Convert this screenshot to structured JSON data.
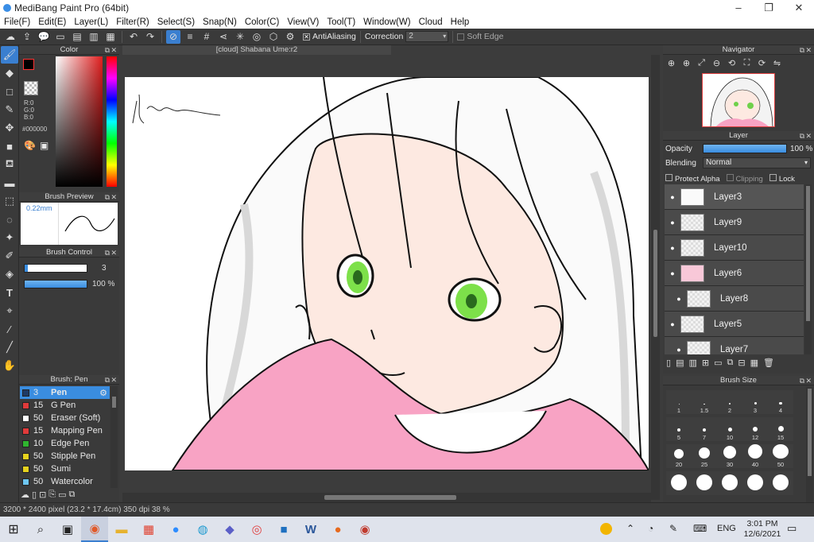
{
  "window": {
    "title": "MediBang Paint Pro (64bit)"
  },
  "menu": [
    "File(F)",
    "Edit(E)",
    "Layer(L)",
    "Filter(R)",
    "Select(S)",
    "Snap(N)",
    "Color(C)",
    "View(V)",
    "Tool(T)",
    "Window(W)",
    "Cloud",
    "Help"
  ],
  "toolbar": {
    "antialiasing_label": "AntiAliasing",
    "correction_label": "Correction",
    "correction_value": "2",
    "softedge_label": "Soft Edge"
  },
  "doc_tab": "[cloud] Shabana Ume:r2",
  "color_panel": {
    "title": "Color",
    "r": "R:0",
    "g": "G:0",
    "b": "B:0",
    "hex": "#000000",
    "primary_color": "#000000"
  },
  "brush_preview": {
    "title": "Brush Preview",
    "size": "0.22mm"
  },
  "brush_control": {
    "title": "Brush Control",
    "size_value": "3",
    "opacity_value": "100 %"
  },
  "brush_list": {
    "title": "Brush: Pen",
    "items": [
      {
        "size": "3",
        "name": "Pen",
        "color": "#1e3a66"
      },
      {
        "size": "15",
        "name": "G Pen",
        "color": "#e03a3a"
      },
      {
        "size": "50",
        "name": "Eraser (Soft)",
        "color": "#ffffff"
      },
      {
        "size": "15",
        "name": "Mapping Pen",
        "color": "#e03a3a"
      },
      {
        "size": "10",
        "name": "Edge Pen",
        "color": "#2fb52f"
      },
      {
        "size": "50",
        "name": "Stipple Pen",
        "color": "#e6d21e"
      },
      {
        "size": "50",
        "name": "Sumi",
        "color": "#e6d21e"
      },
      {
        "size": "50",
        "name": "Watercolor",
        "color": "#6ec6f0"
      }
    ]
  },
  "navigator": {
    "title": "Navigator"
  },
  "layer_panel": {
    "title": "Layer",
    "opacity_label": "Opacity",
    "opacity_value": "100 %",
    "blending_label": "Blending",
    "blending_value": "Normal",
    "protect_alpha": "Protect Alpha",
    "clipping": "Clipping",
    "lock": "Lock",
    "layers": [
      {
        "name": "Layer3"
      },
      {
        "name": "Layer9"
      },
      {
        "name": "Layer10"
      },
      {
        "name": "Layer6"
      },
      {
        "name": "Layer8"
      },
      {
        "name": "Layer5"
      },
      {
        "name": "Layer7"
      }
    ]
  },
  "brush_size": {
    "title": "Brush Size",
    "sizes": [
      "1",
      "1.5",
      "2",
      "3",
      "4",
      "5",
      "7",
      "10",
      "12",
      "15",
      "20",
      "25",
      "30",
      "40",
      "50"
    ]
  },
  "status": {
    "dimensions": "3200 * 2400 pixel",
    "physical": "(23.2 * 17.4cm)",
    "dpi": "350 dpi",
    "zoom": "38 %"
  },
  "taskbar": {
    "lang": "ENG",
    "time": "3:01 PM",
    "date": "12/6/2021"
  },
  "icons": [
    "brush-icon",
    "eraser-icon",
    "rectangle-icon",
    "pen-icon",
    "move-icon",
    "fill-rect-icon",
    "bucket-icon",
    "gradient-icon",
    "select-rect-icon",
    "lasso-icon",
    "magic-wand-icon",
    "select-pen-icon",
    "select-eraser-icon",
    "text-icon",
    "operation-icon",
    "eyedropper-icon",
    "dropper-icon",
    "hand-icon"
  ]
}
